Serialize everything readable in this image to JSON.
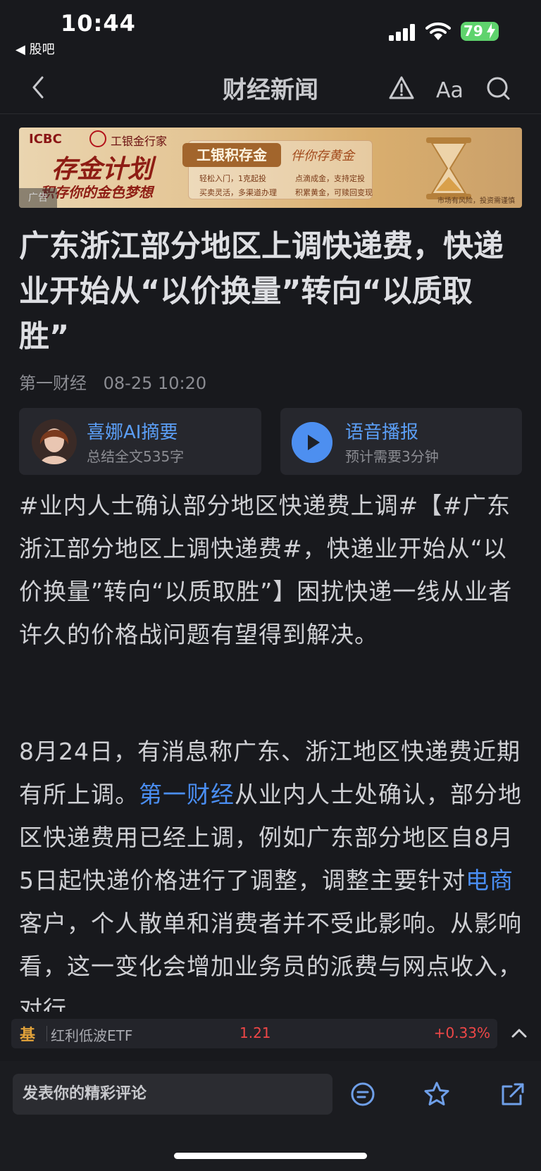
{
  "status_bar": {
    "time": "10:44",
    "back_app": "◀ 股吧",
    "battery": "79"
  },
  "nav": {
    "title": "财经新闻"
  },
  "ad": {
    "bank": "ICBC",
    "bank_sub": "工银金行家",
    "headline": "存金计划",
    "slogan": "积存你的金色梦想",
    "product": "工银积存金",
    "script": "伴你存黄金",
    "features": [
      "轻松入门，1克起投",
      "点滴成金，支持定投",
      "买卖灵活，多渠道办理",
      "积累黄金，可赎回变现"
    ],
    "tag": "广告",
    "disclaimer": "市场有风险，投资需谨慎"
  },
  "article": {
    "headline": "广东浙江部分地区上调快递费，快递业开始从“以价换量”转向“以质取胜”",
    "source": "第一财经",
    "datetime": "08-25 10:20",
    "para1": "#业内人士确认部分地区快递费上调#【#广东浙江部分地区上调快递费#，快递业开始从“以价换量”转向“以质取胜”】困扰快递一线从业者许久的价格战问题有望得到解决。",
    "para2_a": "8月24日，有消息称广东、浙江地区快递费近期有所上调。",
    "para2_link1": "第一财经",
    "para2_b": "从业内人士处确认，部分地区快递费用已经上调，例如广东部分地区自8月5日起快递价格进行了调整，调整主要针对",
    "para2_link2": "电商",
    "para2_c": "客户，个人散单和消费者并不受此影响。从影响看，这一变化会增加业务员的派费与网点收入，对行"
  },
  "cards": {
    "ai_title": "喜娜AI摘要",
    "ai_sub": "总结全文535字",
    "audio_title": "语音播报",
    "audio_sub": "预计需要3分钟"
  },
  "ticker": {
    "badge": "基",
    "name": "红利低波ETF",
    "price": "1.21",
    "change": "+0.33%"
  },
  "bottom": {
    "comment_placeholder": "发表你的精彩评论"
  },
  "colors": {
    "background": "#18191d",
    "link": "#4a8ef2",
    "up": "#ef4747",
    "battery": "#5fd36d"
  }
}
